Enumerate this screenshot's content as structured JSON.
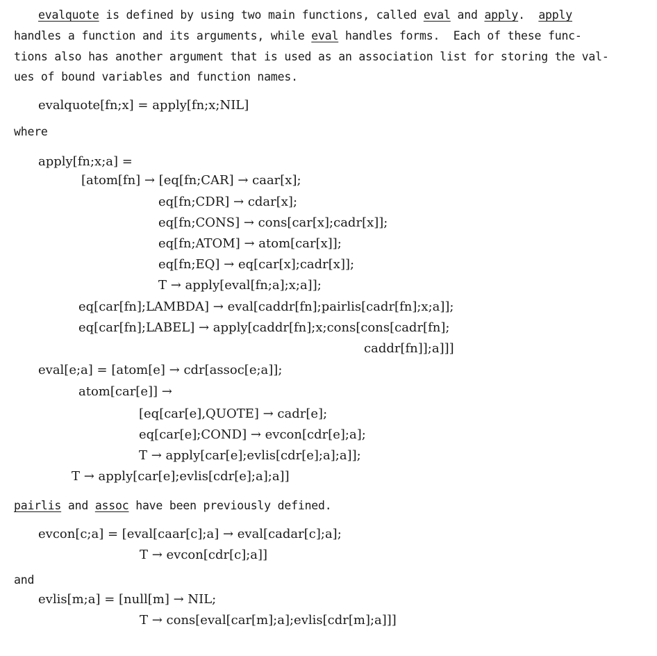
{
  "intro": {
    "line1": [
      {
        "t": "evalquote",
        "u": true
      },
      {
        "t": " is defined by using two main functions, called "
      },
      {
        "t": "eval",
        "u": true
      },
      {
        "t": " and "
      },
      {
        "t": "apply",
        "u": true
      },
      {
        "t": ".  "
      },
      {
        "t": "apply",
        "u": true
      }
    ],
    "line2": [
      {
        "t": "handles a function and its arguments, while "
      },
      {
        "t": "eval",
        "u": true
      },
      {
        "t": " handles forms.  Each of these func-"
      }
    ],
    "line3": "tions also has another argument that is used as an association list for storing the val-",
    "line4": "ues of bound variables and function names."
  },
  "evalquote_def": "evalquote[fn;x] = apply[fn;x;NIL]",
  "where_word": "where",
  "apply_def": [
    "apply[fn;x;a] =",
    "[atom[fn] → [eq[fn;CAR] → caar[x];",
    "eq[fn;CDR] → cdar[x];",
    "eq[fn;CONS] → cons[car[x];cadr[x]];",
    "eq[fn;ATOM] → atom[car[x]];",
    "eq[fn;EQ] → eq[car[x];cadr[x]];",
    "T → apply[eval[fn;a];x;a]];",
    "eq[car[fn];LAMBDA] → eval[caddr[fn];pairlis[cadr[fn];x;a]];",
    "eq[car[fn];LABEL] → apply[caddr[fn];x;cons[cons[cadr[fn];",
    "caddr[fn]];a]]]"
  ],
  "eval_def": [
    "eval[e;a] = [atom[e] → cdr[assoc[e;a]];",
    "atom[car[e]] →",
    "[eq[car[e],QUOTE] → cadr[e];",
    "eq[car[e];COND] → evcon[cdr[e];a];",
    "T → apply[car[e];evlis[cdr[e];a];a]];",
    "T → apply[car[e];evlis[cdr[e];a];a]]"
  ],
  "note": [
    {
      "t": "pairlis",
      "u": true
    },
    {
      "t": " and "
    },
    {
      "t": "assoc",
      "u": true
    },
    {
      "t": " have been previously defined."
    }
  ],
  "evcon_def": [
    "evcon[c;a] = [eval[caar[c];a] → eval[cadar[c];a];",
    "T → evcon[cdr[c];a]]"
  ],
  "and_word": "and",
  "evlis_def": [
    "evlis[m;a] = [null[m] → NIL;",
    "T → cons[eval[car[m];a];evlis[cdr[m];a]]]"
  ]
}
